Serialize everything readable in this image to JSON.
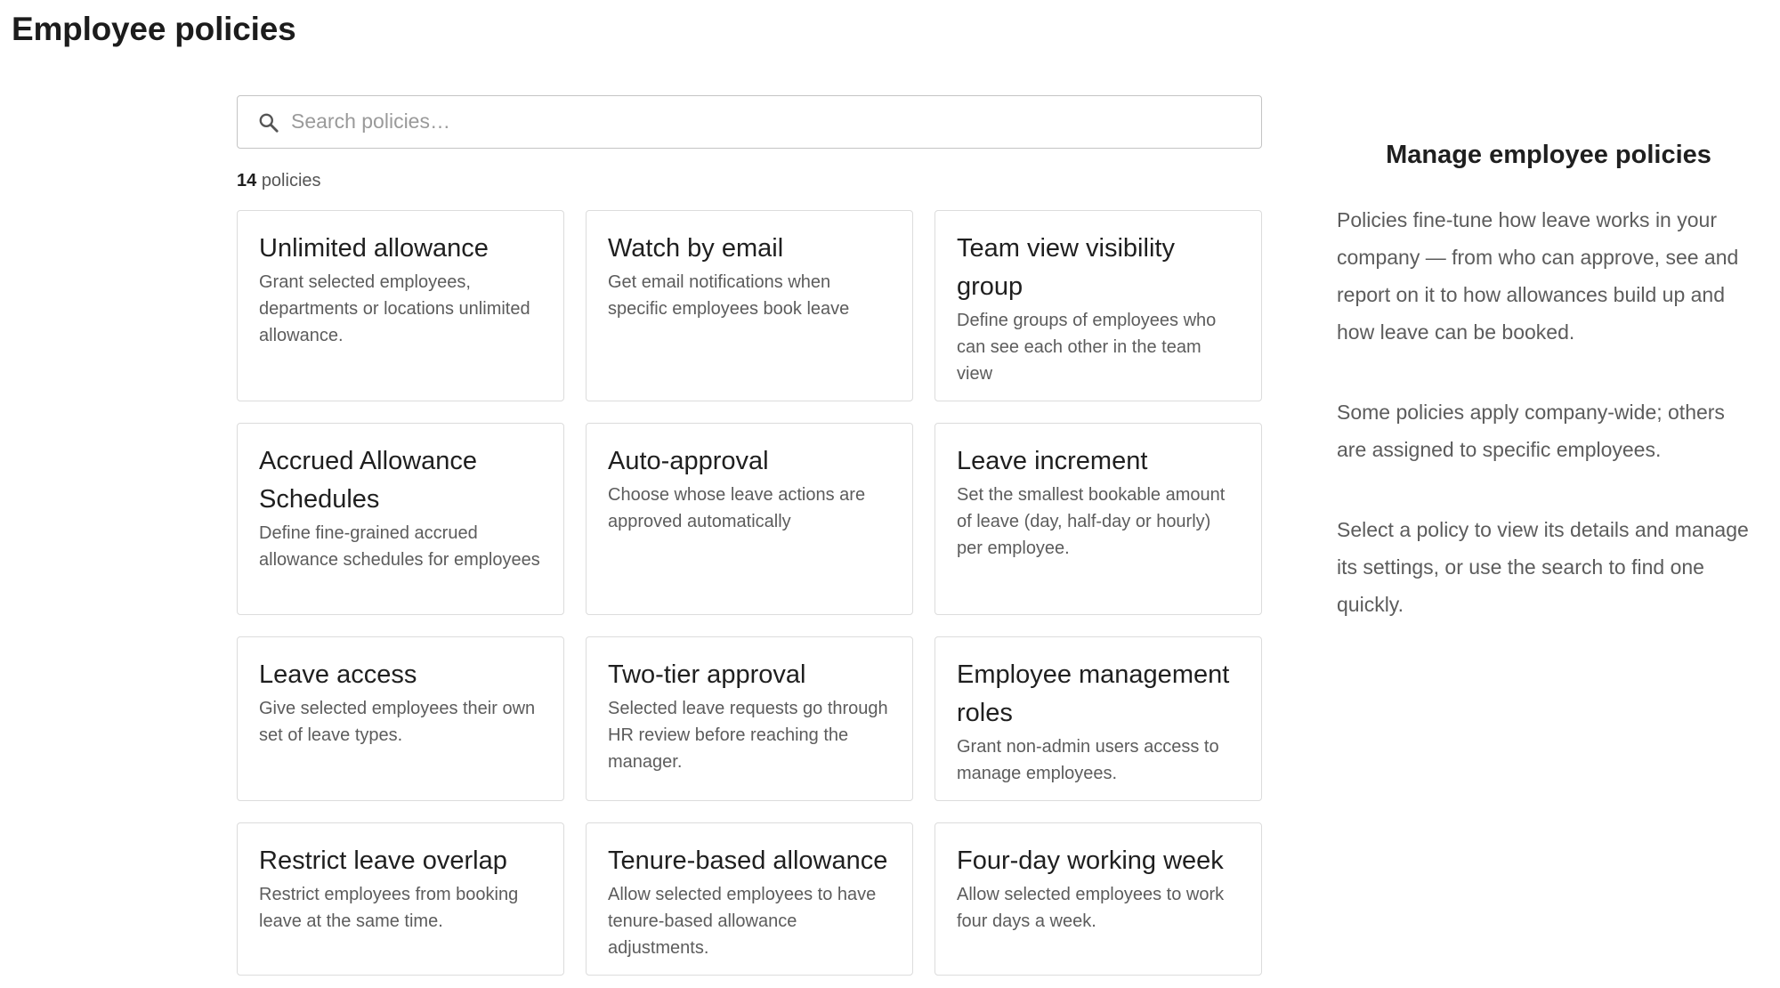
{
  "page": {
    "title": "Employee policies"
  },
  "search": {
    "placeholder": "Search policies…",
    "value": ""
  },
  "count": {
    "number": "14",
    "label": "policies"
  },
  "policies": [
    {
      "title": "Unlimited allowance",
      "description": "Grant selected employees, departments or locations unlimited allowance."
    },
    {
      "title": "Watch by email",
      "description": "Get email notifications when specific employees book leave"
    },
    {
      "title": "Team view visibility group",
      "description": "Define groups of employees who can see each other in the team view"
    },
    {
      "title": "Accrued Allowance Schedules",
      "description": "Define fine-grained accrued allowance schedules for employees"
    },
    {
      "title": "Auto-approval",
      "description": "Choose whose leave actions are approved automatically"
    },
    {
      "title": "Leave increment",
      "description": "Set the smallest bookable amount of leave (day, half-day or hourly) per employee."
    },
    {
      "title": "Leave access",
      "description": "Give selected employees their own set of leave types."
    },
    {
      "title": "Two-tier approval",
      "description": "Selected leave requests go through HR review before reaching the manager."
    },
    {
      "title": "Employee management roles",
      "description": "Grant non-admin users access to manage employees."
    },
    {
      "title": "Restrict leave overlap",
      "description": "Restrict employees from booking leave at the same time."
    },
    {
      "title": "Tenure-based allowance",
      "description": "Allow selected employees to have tenure-based allowance adjustments."
    },
    {
      "title": "Four-day working week",
      "description": "Allow selected employees to work four days a week."
    }
  ],
  "sidebar": {
    "title": "Manage employee policies",
    "paragraphs": [
      "Policies fine-tune how leave works in your company — from who can approve, see and report on it to how allowances build up and how leave can be booked.",
      "Some policies apply company-wide; others are assigned to specific employees.",
      "Select a policy to view its details and manage its settings, or use the search to find one quickly."
    ]
  },
  "icons": {
    "search": "search-icon"
  },
  "colors": {
    "card_border": "#dcdcdc",
    "muted_text": "#5c5c5c",
    "title_text": "#1f1f1f"
  }
}
